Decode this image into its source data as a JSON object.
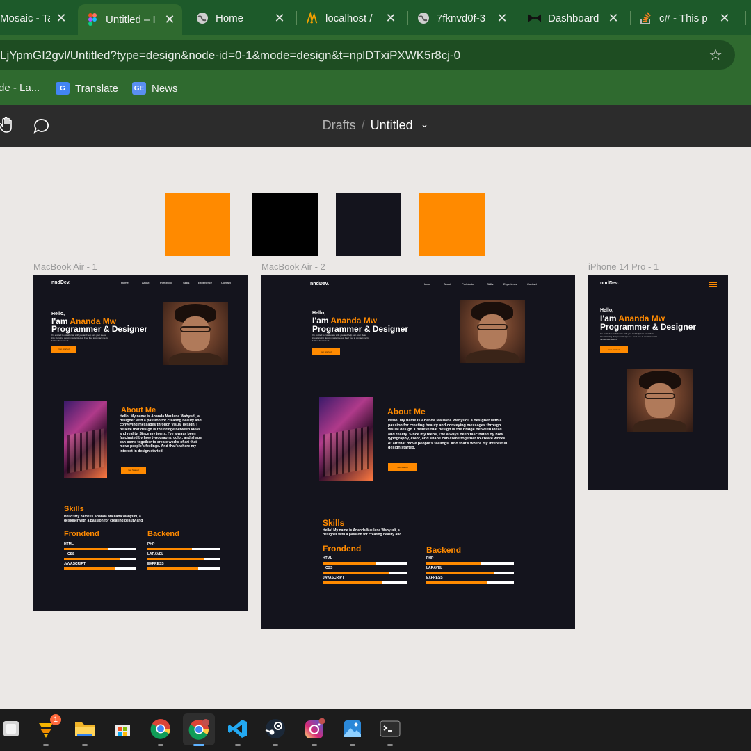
{
  "browser": {
    "tabs": [
      {
        "title": "Mosaic - Ta",
        "icon": "mosaic-icon",
        "active": false
      },
      {
        "title": "Untitled – I",
        "icon": "figma-icon",
        "active": true
      },
      {
        "title": "Home",
        "icon": "globe-icon",
        "active": false
      },
      {
        "title": "localhost /",
        "icon": "phpmyadmin-icon",
        "active": false
      },
      {
        "title": "7fknvd0f-3",
        "icon": "globe-icon",
        "active": false
      },
      {
        "title": "Dashboard",
        "icon": "bowtie-icon",
        "active": false
      },
      {
        "title": "c# - This p",
        "icon": "stackoverflow-icon",
        "active": false
      }
    ],
    "close_glyph": "✕",
    "url": "LjYpmGI2gvl/Untitled?type=design&node-id=0-1&mode=design&t=nplDTxiPXWK5r8cj-0",
    "bookmarks": [
      {
        "label": "de - La...",
        "icon": "none"
      },
      {
        "label": "Translate",
        "icon": "google-translate-icon"
      },
      {
        "label": "News",
        "icon": "google-news-icon"
      }
    ]
  },
  "figma": {
    "breadcrumb": {
      "parent": "Drafts",
      "separator": "/",
      "current": "Untitled",
      "caret": "⌄"
    },
    "swatches": [
      "#ff8a00",
      "#000000",
      "#14141d",
      "#ff8a00"
    ],
    "frames": {
      "macbook1": {
        "label": "MacBook Air - 1"
      },
      "macbook2": {
        "label": "MacBook Air - 2"
      },
      "iphone": {
        "label": "iPhone 14 Pro - 1"
      }
    },
    "site": {
      "logo": "nndDev.",
      "nav": [
        "Home",
        "About",
        "Portofolio",
        "Skills",
        "Experience",
        "Contact"
      ],
      "hello": "Hello,",
      "iam": "I'am ",
      "name": "Ananda Mw",
      "role": "Programmer & Designer",
      "intro_line1": "I'm excited to collaborate with you and help turn your ideas",
      "intro_line2": "into stunning design masterpieces. Feel free to contact me for",
      "intro_line3": "further discussion!",
      "cta": "Get Started",
      "about_title": "About Me",
      "about_lines_narrow": [
        "Hello! My name is Ananda Maulana Wahyudi, a",
        "designer with a passion for creating beauty and",
        "conveying messages through visual design. I",
        "believe that design is the bridge between ideas",
        "and reality. Since my teens, I've always been",
        "fascinated by how typography, color, and shape",
        "can come together to create works of art that",
        "move people's feelings. And that's where my",
        "interest in design started."
      ],
      "about_lines_wide": [
        "Hello! My name is Ananda Maulana Wahyudi, a designer with a",
        "passion for creating beauty and conveying messages through",
        "visual design. I believe that design is the bridge between ideas",
        "and reality. Since my teens, I've always been fascinated by how",
        "typography, color, and shape can come together to create works",
        "of art that move people's feelings. And that's where my interest in",
        "design started."
      ],
      "skills_title": "Skills",
      "skills_line1": "Hello! My name is Ananda Maulana Wahyudi, a",
      "skills_line2": "designer with a passion for creating beauty and",
      "frontend_title": "Frondend",
      "backend_title": "Backend",
      "frontend": [
        {
          "label": "HTML",
          "level": 0.62
        },
        {
          "label": "CSS",
          "level": 0.78
        },
        {
          "label": "JAVASCRIPT",
          "level": 0.7
        }
      ],
      "backend": [
        {
          "label": "PHP",
          "level": 0.62
        },
        {
          "label": "LARAVEL",
          "level": 0.78
        },
        {
          "label": "EXPRESS",
          "level": 0.7
        }
      ]
    }
  },
  "taskbar": {
    "apps": [
      "windows-icon",
      "pinned-app-icon",
      "file-explorer-icon",
      "microsoft-store-icon",
      "chrome-icon",
      "chrome-profile-icon",
      "vscode-icon",
      "steam-icon",
      "instagram-icon",
      "photos-icon",
      "terminal-icon"
    ],
    "notification_count": "1"
  }
}
